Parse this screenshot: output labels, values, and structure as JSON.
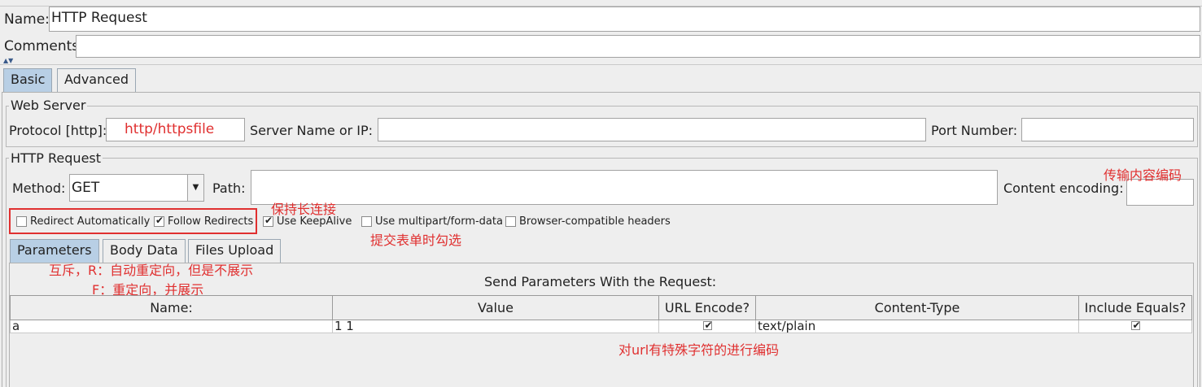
{
  "header": {
    "name_label": "Name:",
    "name_value": "HTTP Request",
    "comments_label": "Comments:",
    "comments_value": ""
  },
  "tabs": [
    {
      "label": "Basic",
      "active": true
    },
    {
      "label": "Advanced",
      "active": false
    }
  ],
  "web_server": {
    "legend": "Web Server",
    "protocol_label": "Protocol [http]:",
    "protocol_value": "",
    "server_label": "Server Name or IP:",
    "server_value": "",
    "port_label": "Port Number:",
    "port_value": ""
  },
  "http_request": {
    "legend": "HTTP Request",
    "method_label": "Method:",
    "method_value": "GET",
    "path_label": "Path:",
    "path_value": "",
    "encoding_label": "Content encoding:",
    "encoding_value": ""
  },
  "options": [
    {
      "label": "Redirect Automatically",
      "checked": false
    },
    {
      "label": "Follow Redirects",
      "checked": true
    },
    {
      "label": "Use KeepAlive",
      "checked": true
    },
    {
      "label": "Use multipart/form-data",
      "checked": false
    },
    {
      "label": "Browser-compatible headers",
      "checked": false
    }
  ],
  "sub_tabs": [
    {
      "label": "Parameters",
      "active": true
    },
    {
      "label": "Body Data",
      "active": false
    },
    {
      "label": "Files Upload",
      "active": false
    }
  ],
  "params": {
    "title": "Send Parameters With the Request:",
    "columns": [
      "Name:",
      "Value",
      "URL Encode?",
      "Content-Type",
      "Include Equals?"
    ],
    "rows": [
      {
        "name": "a",
        "value": "1 1",
        "url_encode": true,
        "content_type": "text/plain",
        "include_equals": true
      }
    ]
  },
  "annotations": {
    "protocol_note": "http/httpsfile",
    "encoding_note": "传输内容编码",
    "keepalive_note": "保持长连接",
    "multipart_note": "提交表单时勾选",
    "redirect_note_1": "互斥，R：自动重定向，但是不展示",
    "redirect_note_2": "F：重定向，并展示",
    "urlencode_note": "对url有特殊字符的进行编码"
  },
  "colors": {
    "annotation": "#e03030",
    "active_tab": "#b8cfe5",
    "background": "#eeeeee"
  }
}
